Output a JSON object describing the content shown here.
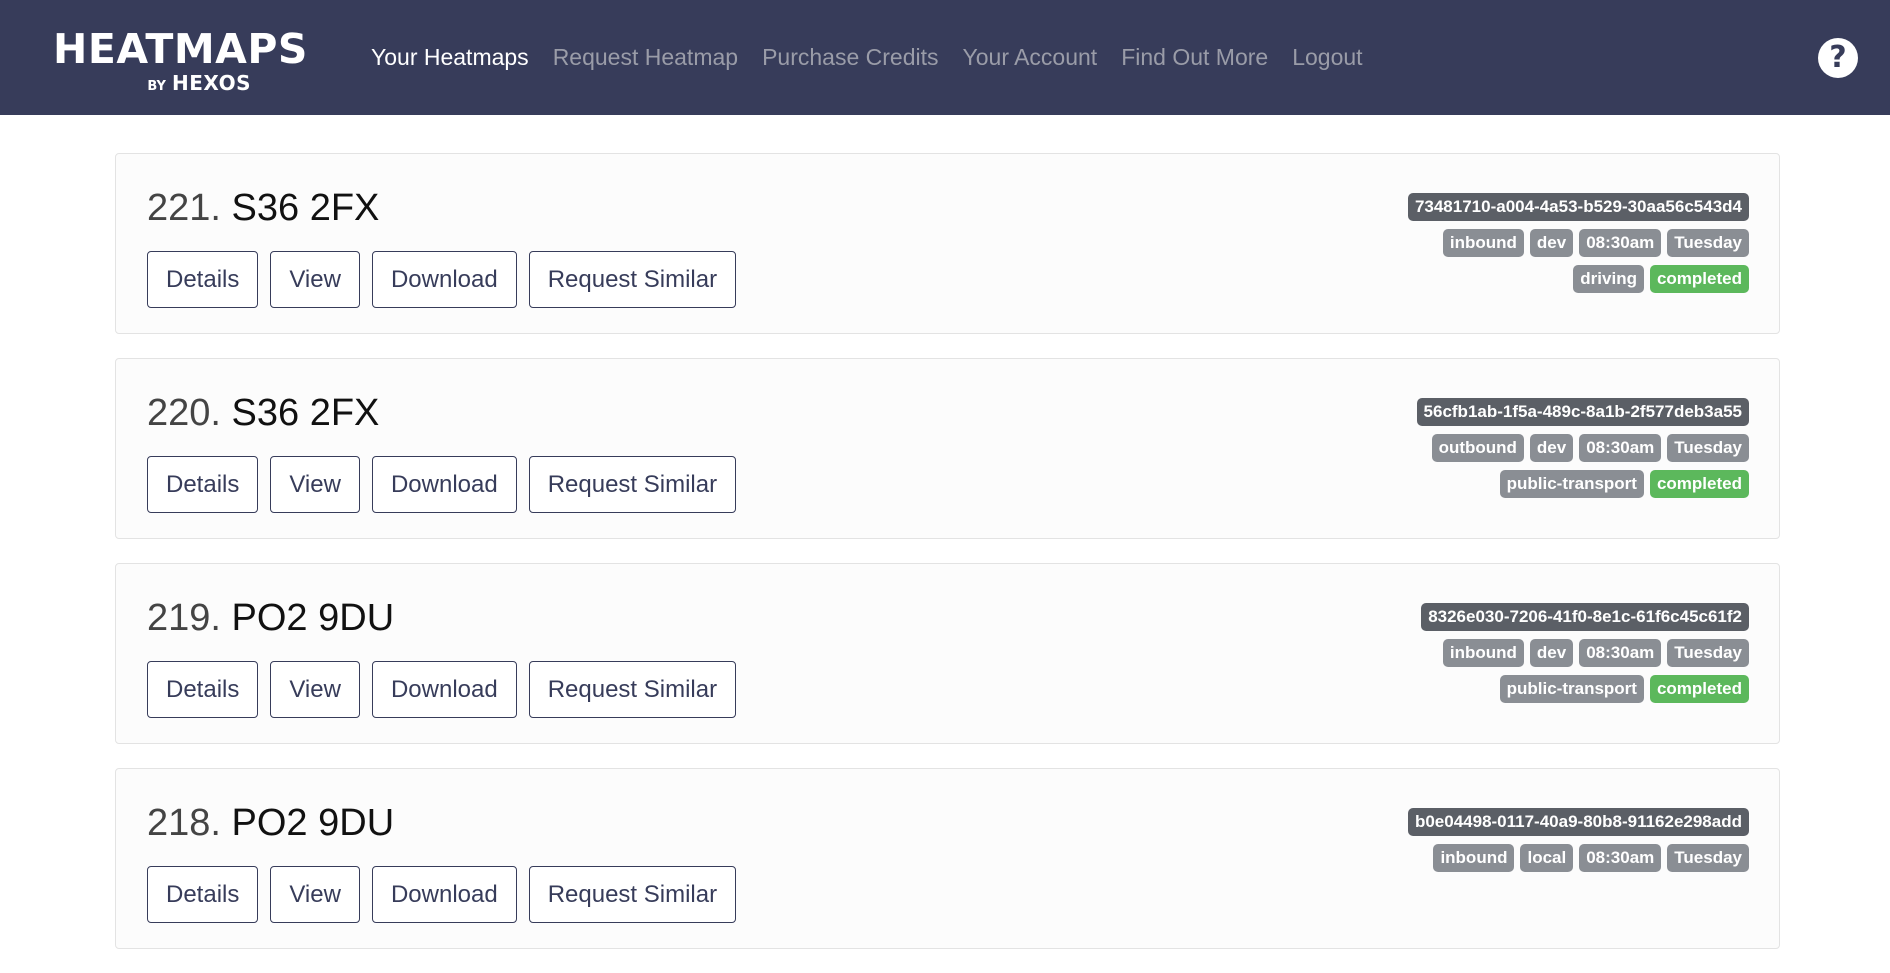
{
  "brand": {
    "main": "HEATMAPS",
    "by": "BY",
    "hexos": "HEXOS"
  },
  "nav": {
    "items": [
      {
        "label": "Your Heatmaps",
        "active": true
      },
      {
        "label": "Request Heatmap",
        "active": false
      },
      {
        "label": "Purchase Credits",
        "active": false
      },
      {
        "label": "Your Account",
        "active": false
      },
      {
        "label": "Find Out More",
        "active": false
      },
      {
        "label": "Logout",
        "active": false
      }
    ],
    "help_icon": "question-circle-icon",
    "help_glyph": "?"
  },
  "buttons": {
    "details": "Details",
    "view": "View",
    "download": "Download",
    "similar": "Request Similar"
  },
  "colors": {
    "navbar": "#373c5a",
    "badge_dark": "#5b5f66",
    "badge_gray": "#8a8e94",
    "badge_success": "#5cb85c"
  },
  "heatmaps": [
    {
      "number": "221.",
      "postcode": "S36 2FX",
      "id": "73481710-a004-4a53-b529-30aa56c543d4",
      "direction": "inbound",
      "env": "dev",
      "time": "08:30am",
      "day": "Tuesday",
      "mode": "driving",
      "status": "completed"
    },
    {
      "number": "220.",
      "postcode": "S36 2FX",
      "id": "56cfb1ab-1f5a-489c-8a1b-2f577deb3a55",
      "direction": "outbound",
      "env": "dev",
      "time": "08:30am",
      "day": "Tuesday",
      "mode": "public-transport",
      "status": "completed"
    },
    {
      "number": "219.",
      "postcode": "PO2 9DU",
      "id": "8326e030-7206-41f0-8e1c-61f6c45c61f2",
      "direction": "inbound",
      "env": "dev",
      "time": "08:30am",
      "day": "Tuesday",
      "mode": "public-transport",
      "status": "completed"
    },
    {
      "number": "218.",
      "postcode": "PO2 9DU",
      "id": "b0e04498-0117-40a9-80b8-91162e298add",
      "direction": "inbound",
      "env": "local",
      "time": "08:30am",
      "day": "Tuesday",
      "mode": "",
      "status": ""
    }
  ]
}
